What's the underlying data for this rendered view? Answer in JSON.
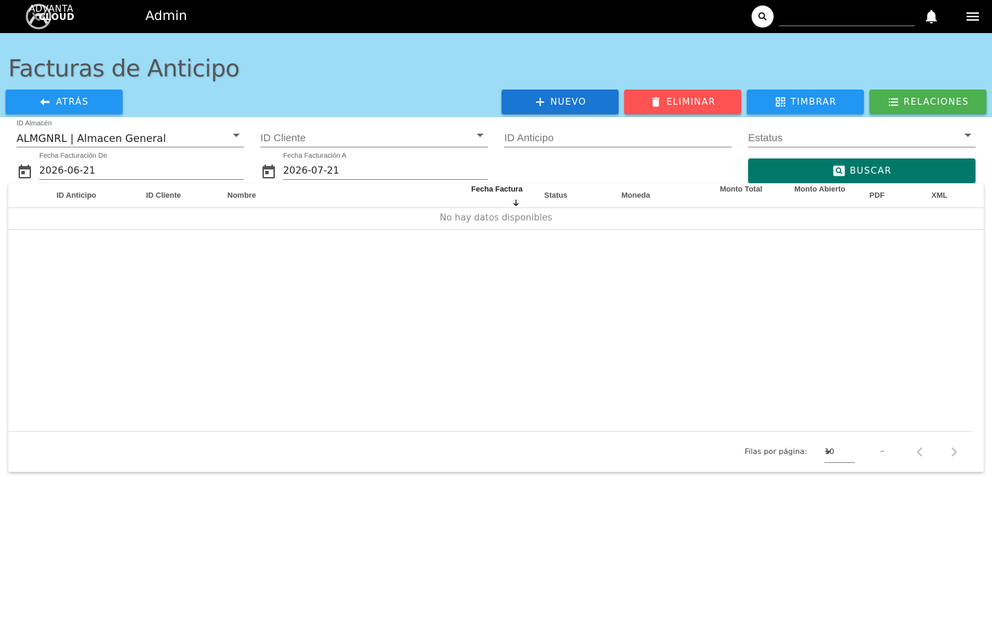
{
  "appbar": {
    "logo_line1": "ADVANTA",
    "logo_line2": "CLOUD",
    "title": "Admin",
    "search_value": ""
  },
  "page": {
    "title": "Facturas de Anticipo"
  },
  "toolbar": {
    "back_label": "ATRÁS",
    "new_label": "NUEVO",
    "delete_label": "ELIMINAR",
    "stamp_label": "TIMBRAR",
    "relations_label": "RELACIONES"
  },
  "filters": {
    "almacen_label": "ID Almacén",
    "almacen_value": "ALMGNRL | Almacen General",
    "cliente_placeholder": "ID Cliente",
    "anticipo_placeholder": "ID Anticipo",
    "estatus_placeholder": "Estatus",
    "fecha_de_label": "Fecha Facturación De",
    "fecha_de_value": "2026-06-21",
    "fecha_a_label": "Fecha Facturación A",
    "fecha_a_value": "2026-07-21",
    "search_label": "BUSCAR"
  },
  "table": {
    "columns": [
      "ID Anticipo",
      "ID Cliente",
      "Nombre",
      "Fecha Factura",
      "Status",
      "Moneda",
      "Monto Total",
      "Monto Abierto",
      "PDF",
      "XML"
    ],
    "empty_text": "No hay datos disponibles",
    "rows_per_page_label": "Filas por página:",
    "rows_per_page_value": "10",
    "range_text": "–"
  },
  "colors": {
    "appbar": "#000000",
    "banner": "#9cdcf7",
    "back": "#2196f3",
    "new": "#1976d2",
    "delete": "#ff5252",
    "stamp": "#2196f3",
    "relations": "#4caf50",
    "search": "#00796b"
  }
}
